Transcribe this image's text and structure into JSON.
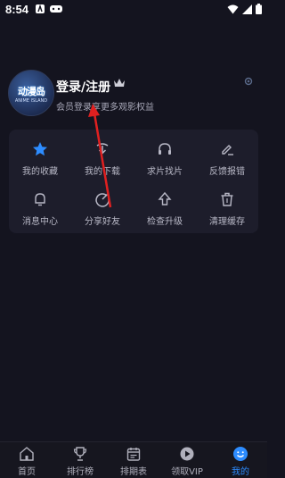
{
  "status_bar": {
    "time": "8:54"
  },
  "profile": {
    "avatar_text": "动漫岛",
    "avatar_subtext": "ANIME ISLAND",
    "login_label": "登录/注册",
    "subtitle": "会员登录享更多观影权益"
  },
  "features": [
    {
      "label": "我的收藏",
      "icon": "star-icon"
    },
    {
      "label": "我的下载",
      "icon": "download-icon"
    },
    {
      "label": "求片找片",
      "icon": "headphones-icon"
    },
    {
      "label": "反馈报错",
      "icon": "edit-icon"
    },
    {
      "label": "消息中心",
      "icon": "bell-icon"
    },
    {
      "label": "分享好友",
      "icon": "share-icon"
    },
    {
      "label": "检查升级",
      "icon": "upgrade-icon"
    },
    {
      "label": "清理缓存",
      "icon": "trash-icon"
    }
  ],
  "tabs": [
    {
      "label": "首页",
      "icon": "home-icon"
    },
    {
      "label": "排行榜",
      "icon": "trophy-icon"
    },
    {
      "label": "排期表",
      "icon": "calendar-icon"
    },
    {
      "label": "领取VIP",
      "icon": "play-icon"
    },
    {
      "label": "我的",
      "icon": "smile-icon",
      "active": true
    }
  ],
  "colors": {
    "background": "#14141f",
    "card": "#1d1d2b",
    "accent": "#2d8cff",
    "annotation_arrow": "#e02020"
  }
}
